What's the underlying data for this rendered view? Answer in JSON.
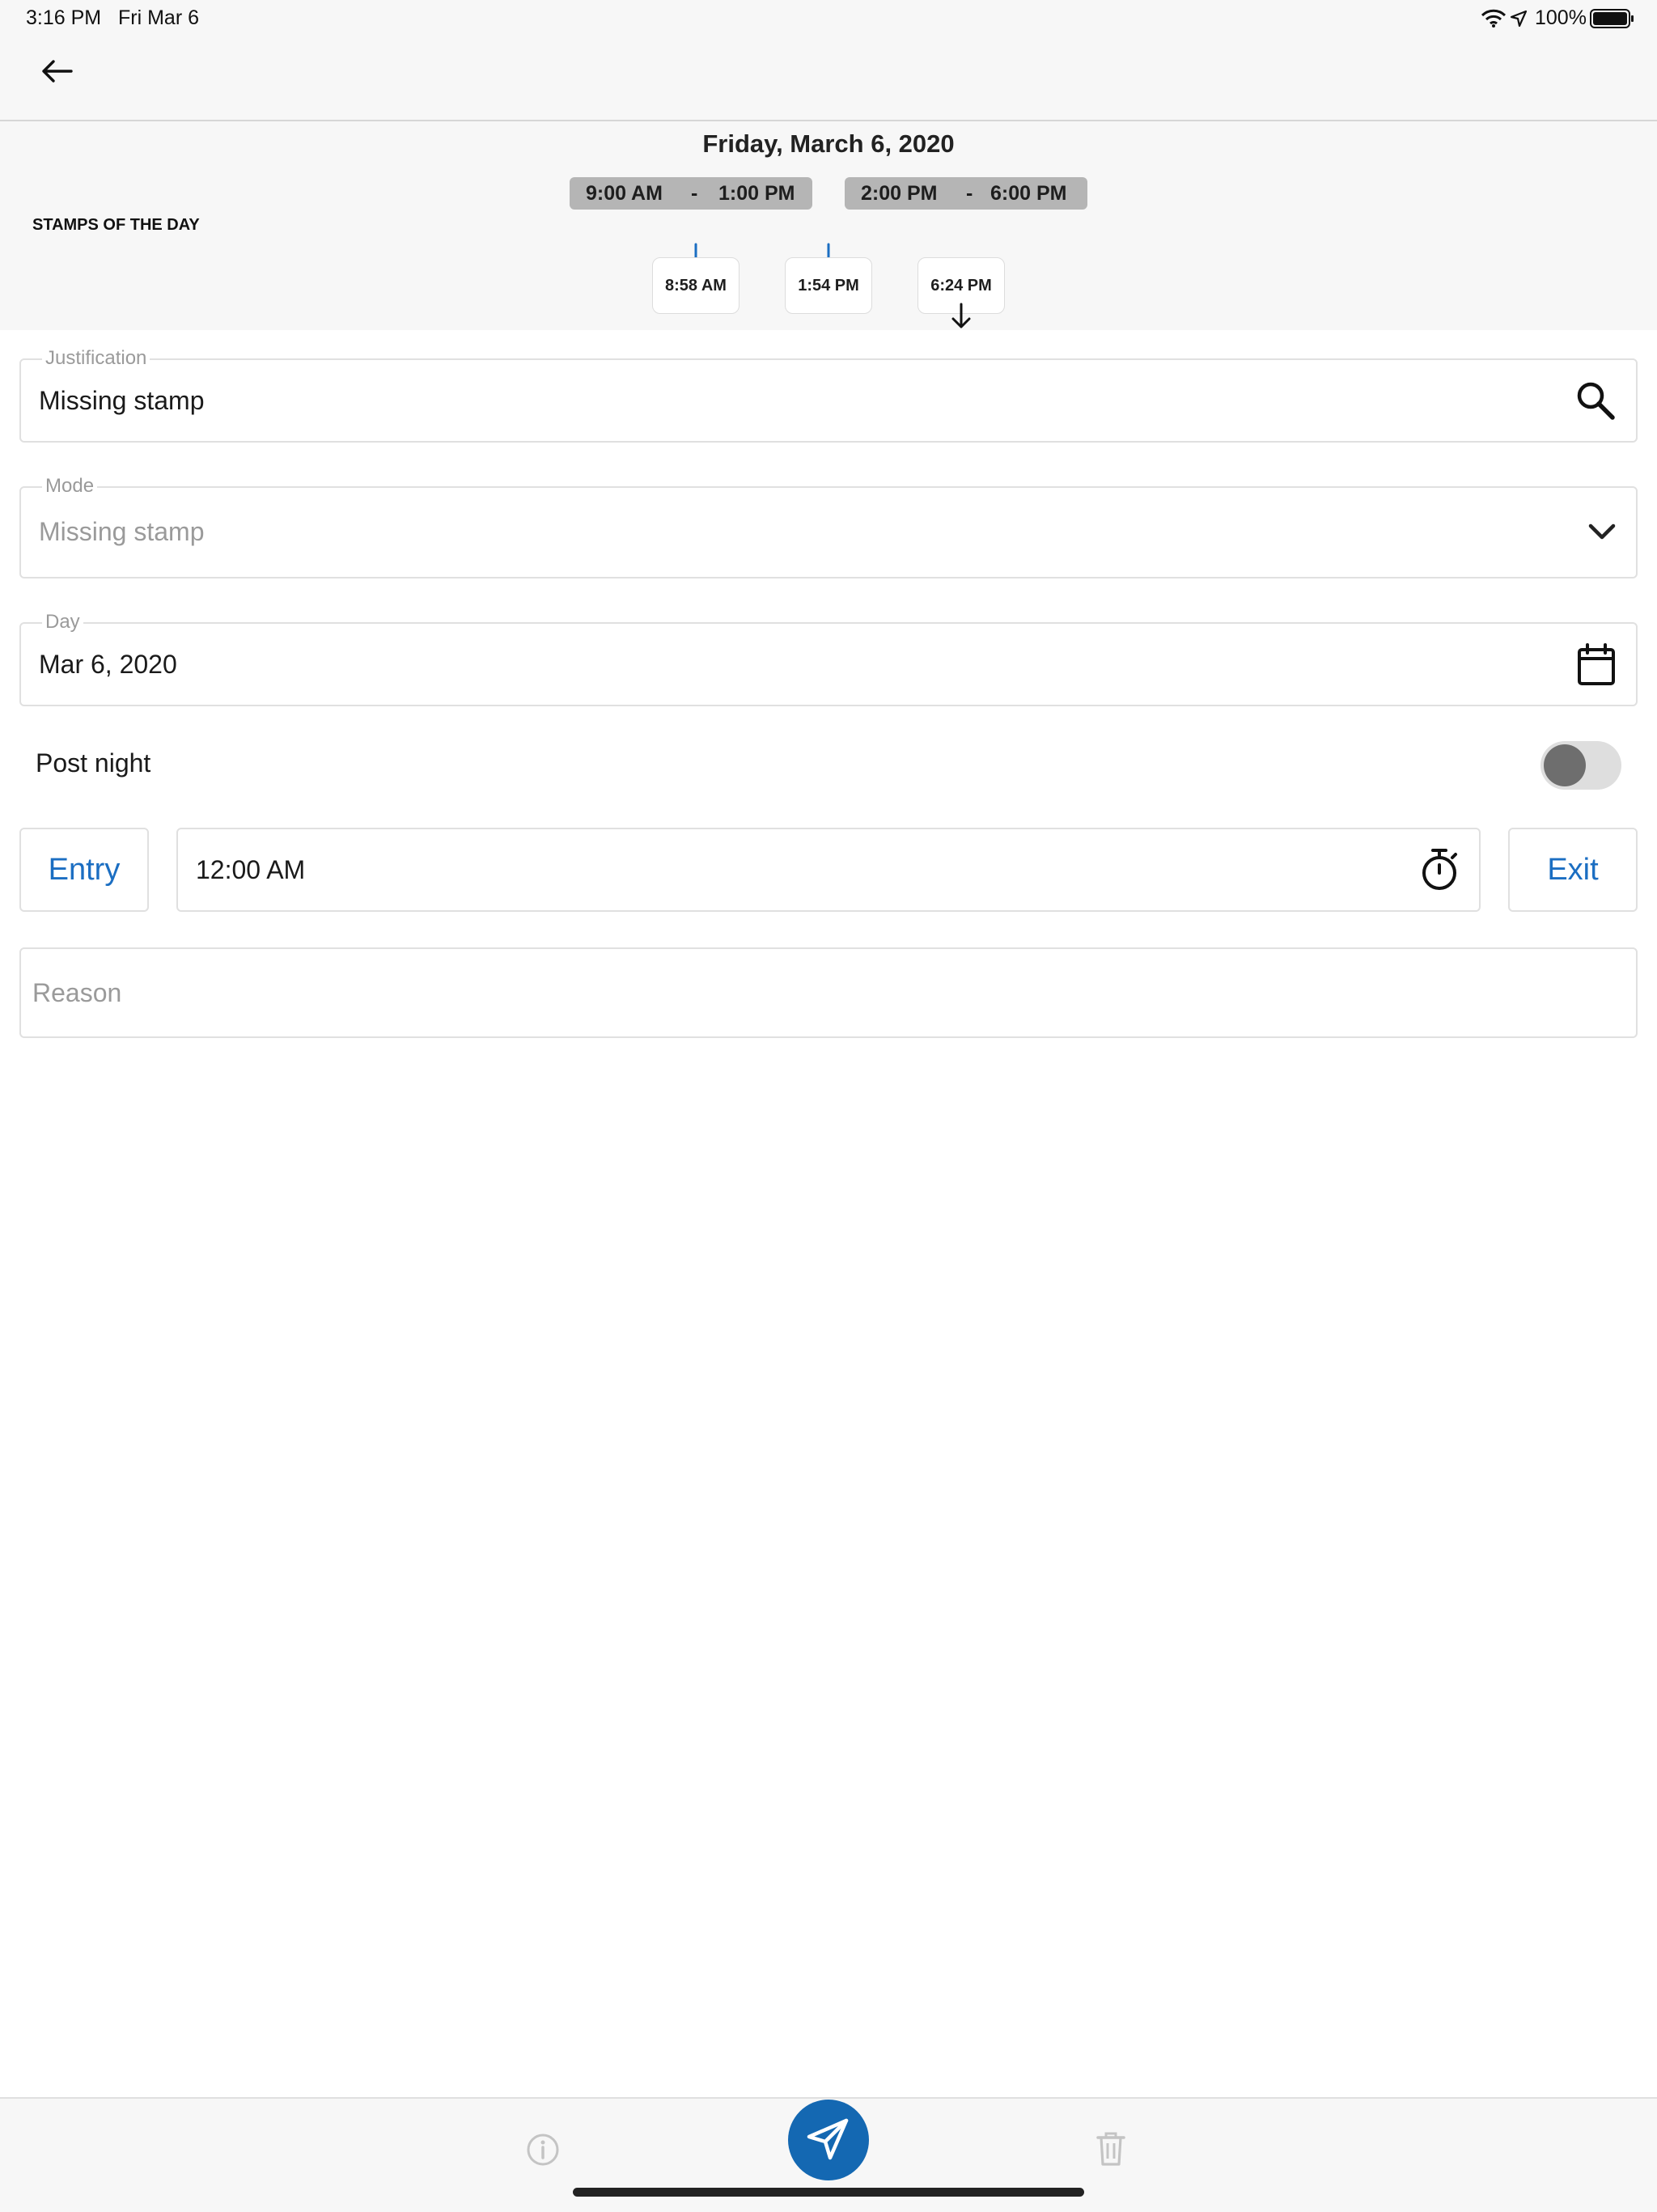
{
  "status_bar": {
    "time": "3:16 PM",
    "date": "Fri Mar 6",
    "battery": "100%"
  },
  "nav": {
    "back_icon": "arrow-left-icon"
  },
  "header": {
    "date_title": "Friday, March 6, 2020",
    "schedules": [
      {
        "start": "9:00 AM",
        "sep": "-",
        "end": "1:00 PM"
      },
      {
        "start": "2:00 PM",
        "sep": "-",
        "end": "6:00 PM"
      }
    ],
    "stamps_label": "STAMPS OF THE DAY",
    "stamps": [
      {
        "time": "8:58 AM",
        "direction": "in",
        "color": "#1b6ec2"
      },
      {
        "time": "1:54 PM",
        "direction": "in",
        "color": "#1b6ec2"
      },
      {
        "time": "6:24 PM",
        "direction": "out",
        "color": "#111111"
      }
    ]
  },
  "form": {
    "justification": {
      "label": "Justification",
      "value": "Missing stamp",
      "icon": "search-icon"
    },
    "mode": {
      "label": "Mode",
      "value": "Missing stamp",
      "icon": "chevron-down-icon"
    },
    "day": {
      "label": "Day",
      "value": "Mar 6, 2020",
      "icon": "calendar-icon"
    },
    "post_night": {
      "label": "Post night",
      "enabled": false
    },
    "entry_button": "Entry",
    "time": {
      "value": "12:00 AM",
      "icon": "stopwatch-icon"
    },
    "exit_button": "Exit",
    "reason": {
      "placeholder": "Reason"
    }
  },
  "bottom_bar": {
    "info_icon": "info-icon",
    "send_icon": "send-icon",
    "delete_icon": "trash-icon"
  },
  "colors": {
    "accent": "#1b6ec2",
    "send_button": "#1468b2",
    "schedule_chip": "#b5b5b5"
  }
}
